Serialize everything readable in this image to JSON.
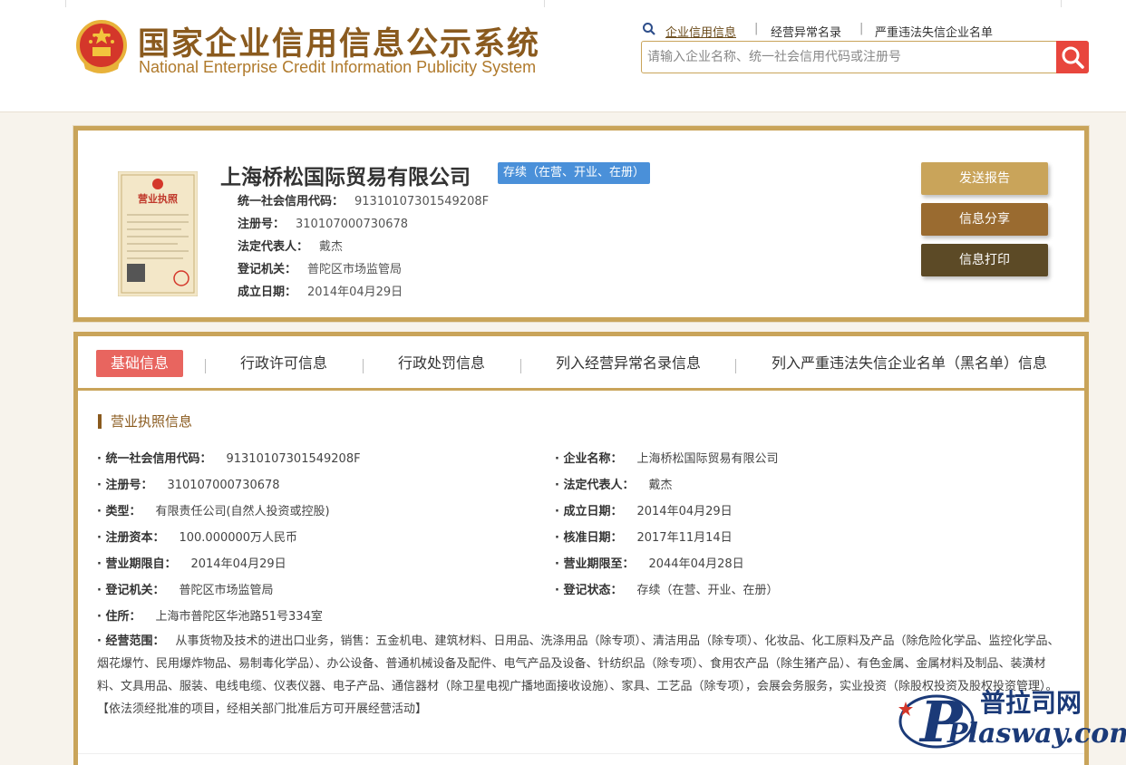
{
  "header": {
    "title_cn": "国家企业信用信息公示系统",
    "title_en": "National Enterprise Credit Information Publicity System",
    "links": [
      "企业信用信息",
      "经营异常名录",
      "严重违法失信企业名单"
    ],
    "search_placeholder": "请输入企业名称、统一社会信用代码或注册号",
    "icons": {
      "emblem": "national-emblem-icon",
      "search": "search-icon",
      "magnifier": "magnifier-icon"
    }
  },
  "company": {
    "name": "上海桥松国际贸易有限公司",
    "status": "存续（在营、开业、在册）",
    "fields": [
      {
        "label": "统一社会信用代码：",
        "value": "91310107301549208F"
      },
      {
        "label": "注册号：",
        "value": "310107000730678"
      },
      {
        "label": "法定代表人：",
        "value": "戴杰"
      },
      {
        "label": "登记机关：",
        "value": "普陀区市场监管局"
      },
      {
        "label": "成立日期：",
        "value": "2014年04月29日"
      }
    ],
    "license_title": "营业执照",
    "actions": [
      "发送报告",
      "信息分享",
      "信息打印"
    ]
  },
  "tabs": [
    "基础信息",
    "行政许可信息",
    "行政处罚信息",
    "列入经营异常名录信息",
    "列入严重违法失信企业名单（黑名单）信息"
  ],
  "license_info": {
    "title": "营业执照信息",
    "left": [
      {
        "label": "统一社会信用代码：",
        "value": "91310107301549208F"
      },
      {
        "label": "注册号：",
        "value": "310107000730678"
      },
      {
        "label": "类型：",
        "value": "有限责任公司(自然人投资或控股)"
      },
      {
        "label": "注册资本：",
        "value": "100.000000万人民币"
      },
      {
        "label": "营业期限自：",
        "value": "2014年04月29日"
      },
      {
        "label": "登记机关：",
        "value": "普陀区市场监管局"
      },
      {
        "label": "住所：",
        "value": "上海市普陀区华池路51号334室"
      }
    ],
    "right": [
      {
        "label": "企业名称：",
        "value": "上海桥松国际贸易有限公司"
      },
      {
        "label": "法定代表人：",
        "value": "戴杰"
      },
      {
        "label": "成立日期：",
        "value": "2014年04月29日"
      },
      {
        "label": "核准日期：",
        "value": "2017年11月14日"
      },
      {
        "label": "营业期限至：",
        "value": "2044年04月28日"
      },
      {
        "label": "登记状态：",
        "value": "存续（在营、开业、在册）"
      }
    ],
    "scope_label": "经营范围：",
    "scope_value": "从事货物及技术的进出口业务，销售：五金机电、建筑材料、日用品、洗涤用品（除专项）、清洁用品（除专项）、化妆品、化工原料及产品（除危险化学品、监控化学品、烟花爆竹、民用爆炸物品、易制毒化学品）、办公设备、普通机械设备及配件、电气产品及设备、针纺织品（除专项）、食用农产品（除生猪产品）、有色金属、金属材料及制品、装潢材料、文具用品、服装、电线电缆、仪表仪器、电子产品、通信器材（除卫星电视广播地面接收设施）、家具、工艺品（除专项），会展会务服务，实业投资（除股权投资及股权投资管理）。【依法须经批准的项目，经相关部门批准后方可开展经营活动】"
  },
  "watermark": {
    "line1": "普拉司网",
    "line2": "Plasway.com"
  }
}
